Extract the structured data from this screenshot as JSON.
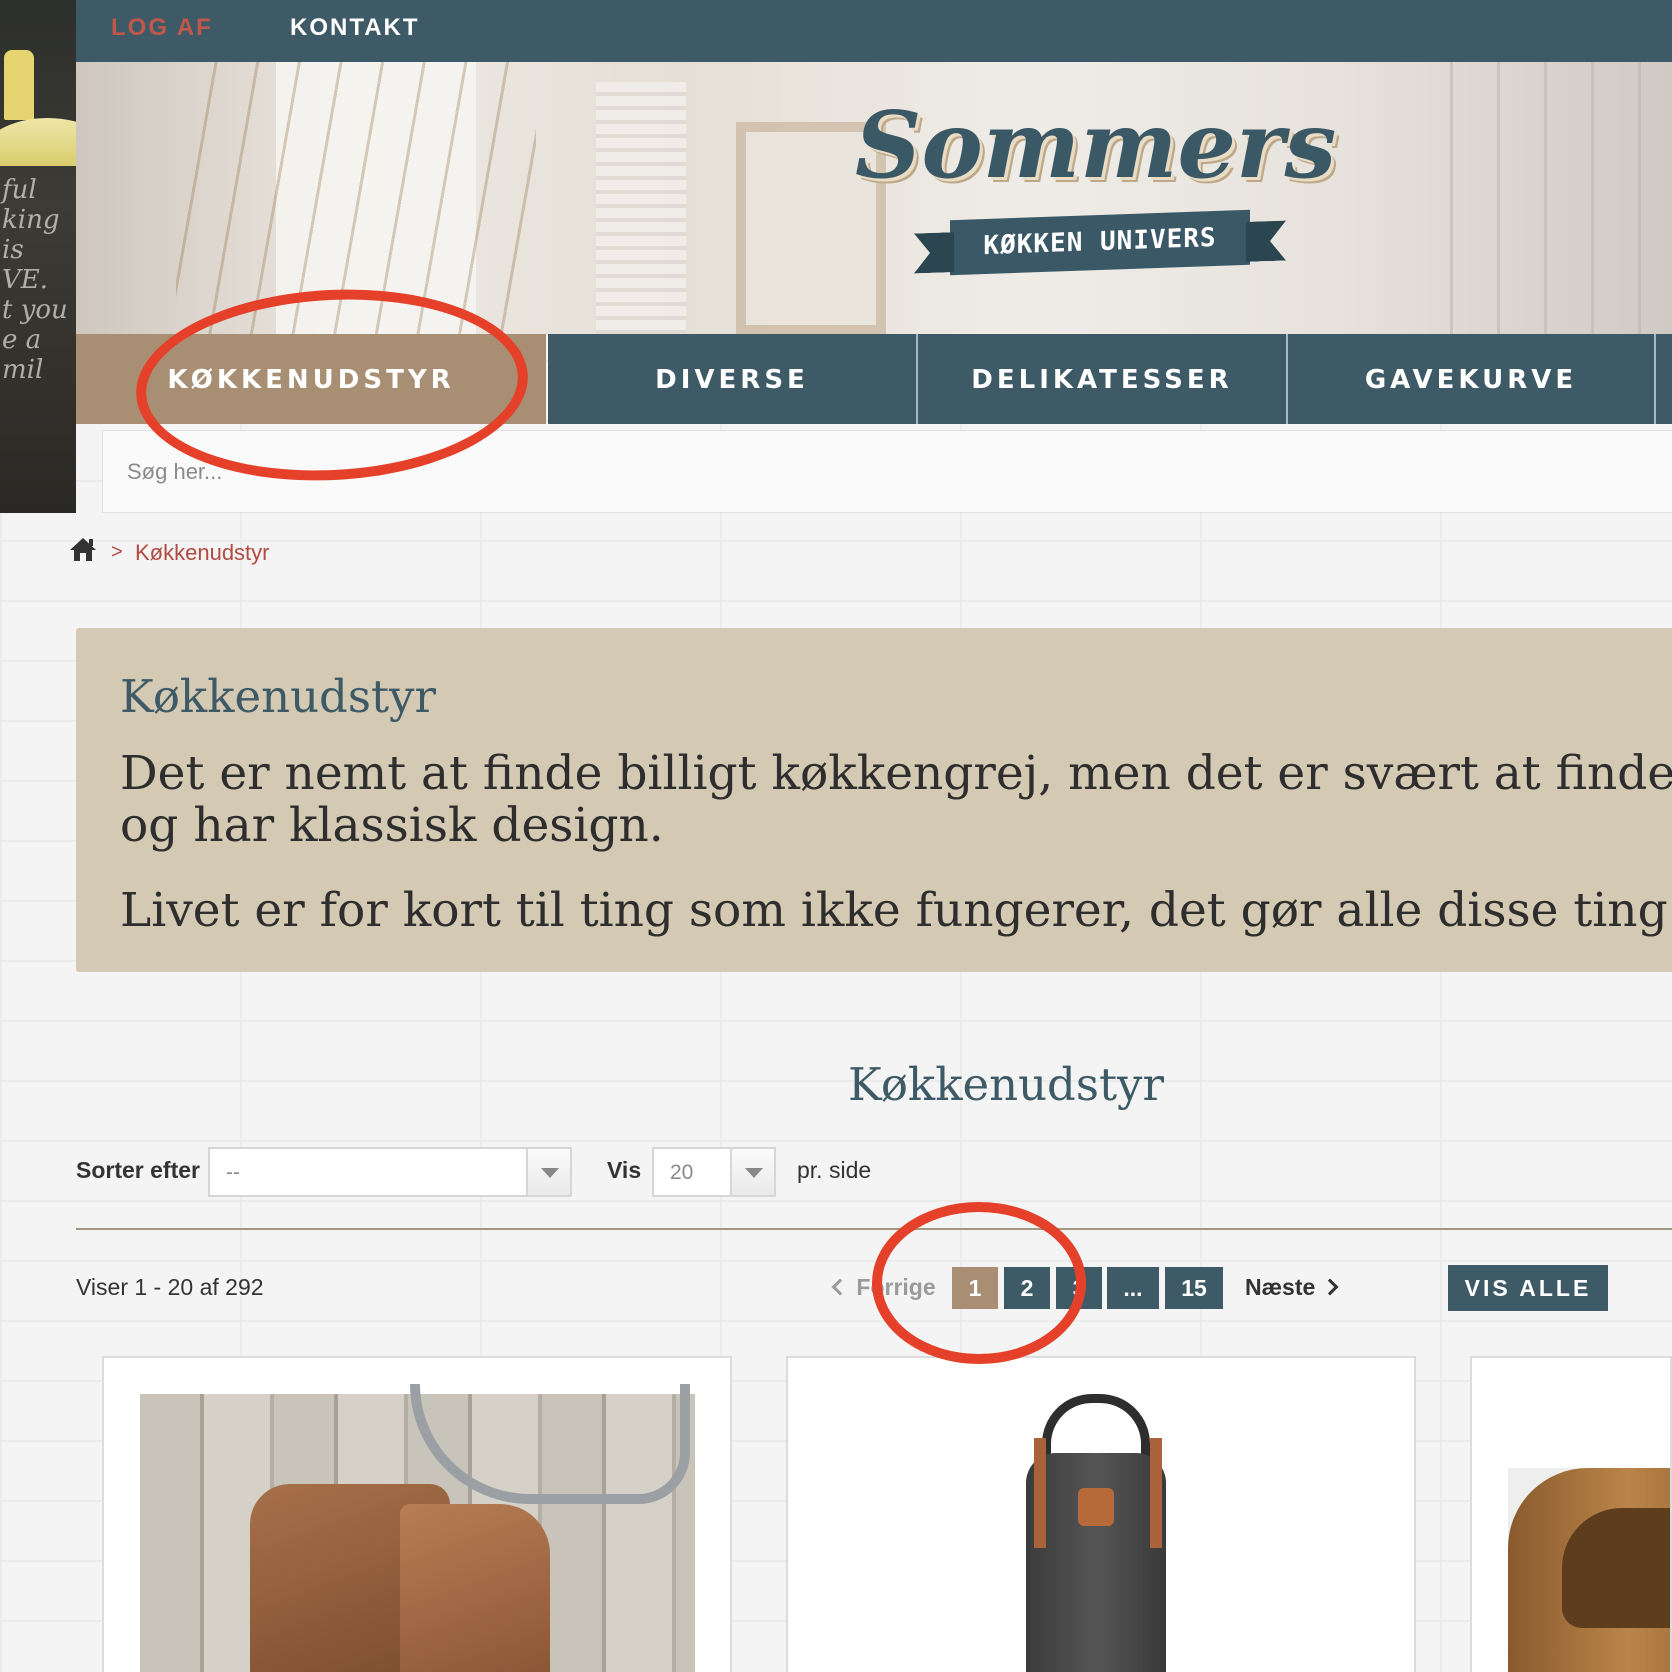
{
  "topbar": {
    "links": [
      {
        "label": "LOG AF"
      },
      {
        "label": "KONTAKT"
      }
    ]
  },
  "logo": {
    "name": "Sommers",
    "tagline": "KØKKEN UNIVERS"
  },
  "nav": {
    "tabs": [
      {
        "label": "KØKKENUDSTYR",
        "active": true
      },
      {
        "label": "DIVERSE"
      },
      {
        "label": "DELIKATESSER"
      },
      {
        "label": "GAVEKURVE"
      }
    ]
  },
  "search": {
    "placeholder": "Søg her..."
  },
  "breadcrumb": {
    "separator": ">",
    "current": "Køkkenudstyr"
  },
  "description": {
    "title": "Køkkenudstyr",
    "line1": "Det er nemt at finde billigt køkkengrej, men det er svært at finde n",
    "line2": "og har klassisk design.",
    "line3": "Livet er for kort til ting som ikke fungerer, det gør alle disse ting ti"
  },
  "listing": {
    "title": "Køkkenudstyr",
    "sort_label": "Sorter efter",
    "sort_value": "--",
    "show_label": "Vis",
    "show_value": "20",
    "per_page_label": "pr. side",
    "count_text": "Viser 1 - 20 af 292",
    "prev_label": "Forrige",
    "pages": [
      "1",
      "2",
      "3",
      "...",
      "15"
    ],
    "current_page": "1",
    "next_label": "Næste",
    "show_all_label": "VIS ALLE"
  },
  "products": [
    {
      "image": "leather-oven-gloves-image"
    },
    {
      "image": "leather-apron-image"
    },
    {
      "image": "wooden-bowl-image"
    }
  ],
  "colors": {
    "primary": "#3e5a67",
    "accent": "#a88f73",
    "link": "#b34a41",
    "panel": "#d4c9b2",
    "annotation": "#e5402a"
  },
  "icons": {
    "home": "home-icon",
    "prev": "chevron-left-icon",
    "next": "chevron-right-icon",
    "dropdown": "chevron-down-icon"
  }
}
